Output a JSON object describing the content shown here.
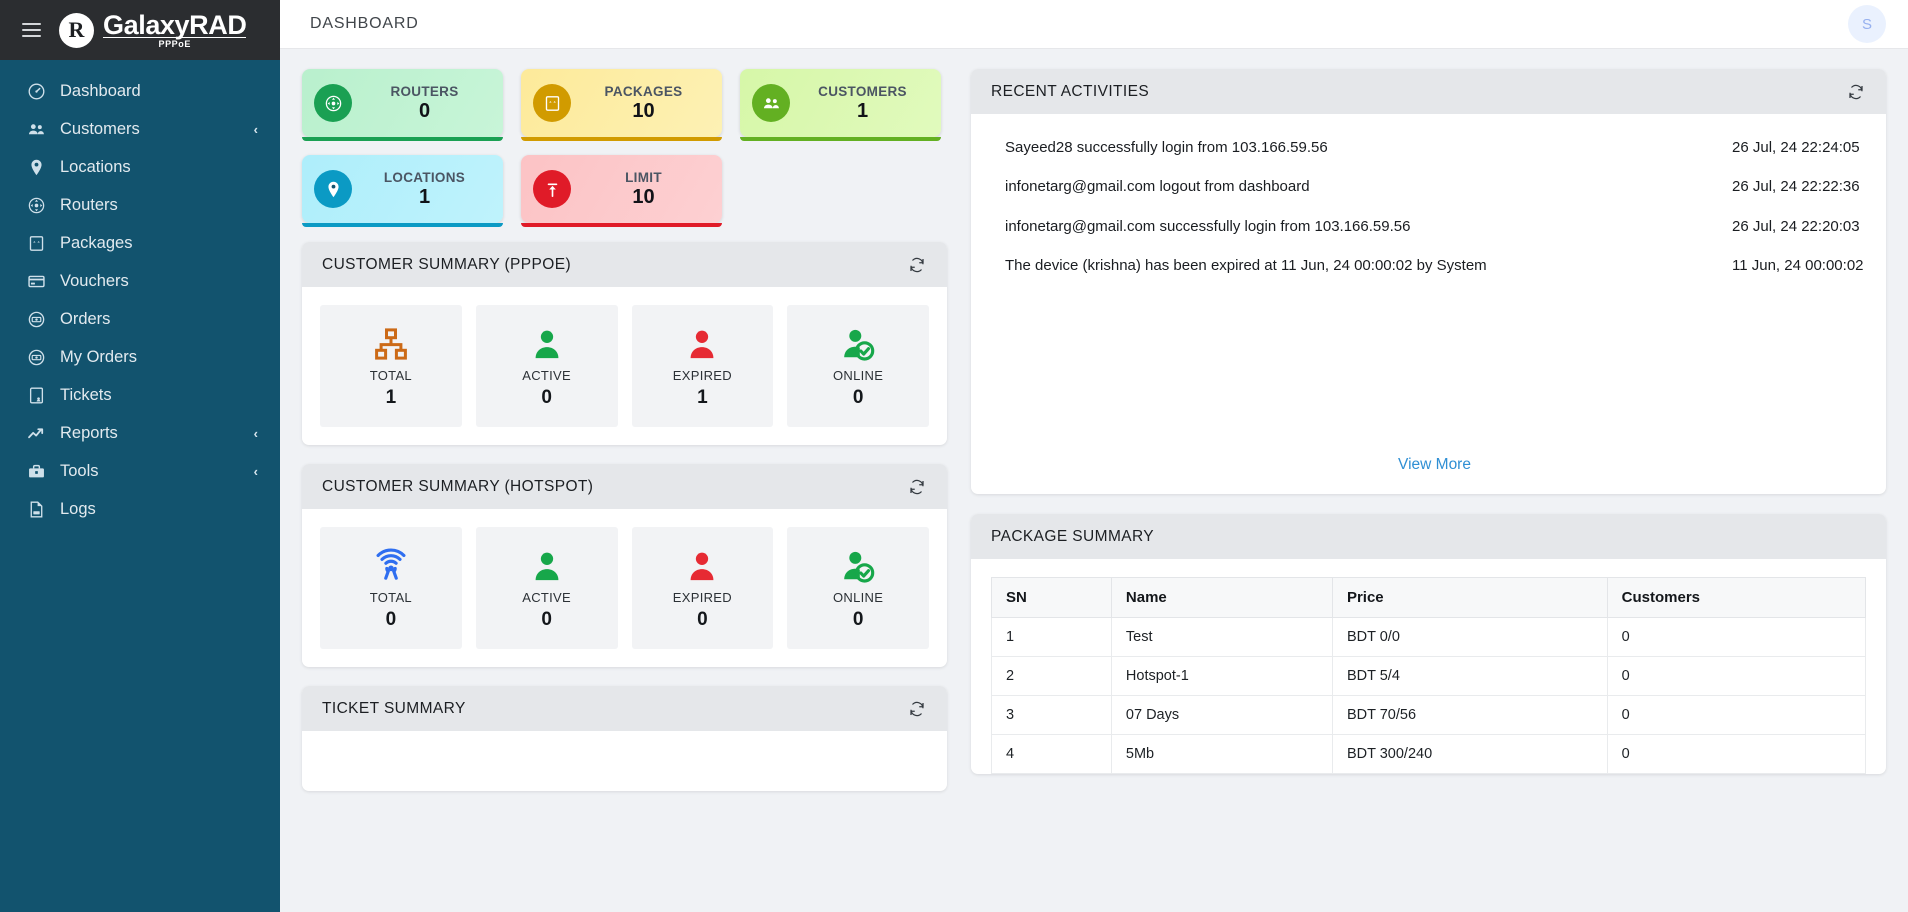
{
  "brand": {
    "mark": "R",
    "name": "GalaxyRAD",
    "sub": "PPPoE"
  },
  "topbar": {
    "title": "DASHBOARD",
    "avatar_initial": "S"
  },
  "sidebar": {
    "items": [
      {
        "label": "Dashboard",
        "icon": "gauge-icon",
        "caret": ""
      },
      {
        "label": "Customers",
        "icon": "users-icon",
        "caret": "‹"
      },
      {
        "label": "Locations",
        "icon": "map-pin-icon",
        "caret": ""
      },
      {
        "label": "Routers",
        "icon": "router-icon",
        "caret": ""
      },
      {
        "label": "Packages",
        "icon": "package-icon",
        "caret": ""
      },
      {
        "label": "Vouchers",
        "icon": "voucher-card-icon",
        "caret": ""
      },
      {
        "label": "Orders",
        "icon": "money-icon",
        "caret": ""
      },
      {
        "label": "My Orders",
        "icon": "money-icon",
        "caret": ""
      },
      {
        "label": "Tickets",
        "icon": "ticket-list-icon",
        "caret": ""
      },
      {
        "label": "Reports",
        "icon": "trend-up-icon",
        "caret": "‹"
      },
      {
        "label": "Tools",
        "icon": "toolbox-icon",
        "caret": "‹"
      },
      {
        "label": "Logs",
        "icon": "log-file-icon",
        "caret": ""
      }
    ]
  },
  "stats": [
    {
      "label": "ROUTERS",
      "value": "0",
      "icon": "router-icon",
      "accent": "#1aa053",
      "bg_from": "#b9f0cd",
      "bg_to": "#c8f5d8"
    },
    {
      "label": "PACKAGES",
      "value": "10",
      "icon": "package-icon",
      "accent": "#d19b00",
      "bg_from": "#fdea9a",
      "bg_to": "#fdf1b4"
    },
    {
      "label": "CUSTOMERS",
      "value": "1",
      "icon": "users-icon",
      "accent": "#63b022",
      "bg_from": "#d6f7a8",
      "bg_to": "#e1fabd"
    },
    {
      "label": "LOCATIONS",
      "value": "1",
      "icon": "map-pin-icon",
      "accent": "#0b9ac4",
      "bg_from": "#aeeefb",
      "bg_to": "#bff3fc"
    },
    {
      "label": "LIMIT",
      "value": "10",
      "icon": "limit-up-icon",
      "accent": "#e01b28",
      "bg_from": "#fcc3c5",
      "bg_to": "#fdd0d2"
    }
  ],
  "pppoe_summary": {
    "title": "CUSTOMER SUMMARY (PPPOE)",
    "refresh": "refresh-icon",
    "tiles": [
      {
        "label": "TOTAL",
        "value": "1",
        "icon": "sitemap-icon",
        "color": "#cc6a17"
      },
      {
        "label": "ACTIVE",
        "value": "0",
        "icon": "user-icon",
        "color": "#17a74a"
      },
      {
        "label": "EXPIRED",
        "value": "1",
        "icon": "user-icon",
        "color": "#e62a33"
      },
      {
        "label": "ONLINE",
        "value": "0",
        "icon": "user-check-icon",
        "color": "#17a74a"
      }
    ]
  },
  "hotspot_summary": {
    "title": "CUSTOMER SUMMARY (HOTSPOT)",
    "refresh": "refresh-icon",
    "tiles": [
      {
        "label": "TOTAL",
        "value": "0",
        "icon": "wifi-signal-icon",
        "color": "#2f6ef0"
      },
      {
        "label": "ACTIVE",
        "value": "0",
        "icon": "user-icon",
        "color": "#17a74a"
      },
      {
        "label": "EXPIRED",
        "value": "0",
        "icon": "user-icon",
        "color": "#e62a33"
      },
      {
        "label": "ONLINE",
        "value": "0",
        "icon": "user-check-icon",
        "color": "#17a74a"
      }
    ]
  },
  "ticket_summary": {
    "title": "TICKET SUMMARY",
    "refresh": "refresh-icon"
  },
  "recent_activities": {
    "title": "RECENT ACTIVITIES",
    "refresh": "refresh-icon",
    "view_more": "View More",
    "rows": [
      {
        "text": "Sayeed28 successfully login from 103.166.59.56",
        "time": "26 Jul, 24 22:24:05"
      },
      {
        "text": "infonetarg@gmail.com logout from dashboard",
        "time": "26 Jul, 24 22:22:36"
      },
      {
        "text": "infonetarg@gmail.com successfully login from 103.166.59.56",
        "time": "26 Jul, 24 22:20:03"
      },
      {
        "text": "The device (krishna) has been expired at 11 Jun, 24 00:00:02 by System",
        "time": "11 Jun, 24 00:00:02"
      }
    ]
  },
  "package_summary": {
    "title": "PACKAGE SUMMARY",
    "columns": [
      "SN",
      "Name",
      "Price",
      "Customers"
    ],
    "rows": [
      {
        "sn": "1",
        "name": "Test",
        "price": "BDT 0/0",
        "customers": "0"
      },
      {
        "sn": "2",
        "name": "Hotspot-1",
        "price": "BDT 5/4",
        "customers": "0"
      },
      {
        "sn": "3",
        "name": "07 Days",
        "price": "BDT 70/56",
        "customers": "0"
      },
      {
        "sn": "4",
        "name": "5Mb",
        "price": "BDT 300/240",
        "customers": "0"
      }
    ]
  }
}
